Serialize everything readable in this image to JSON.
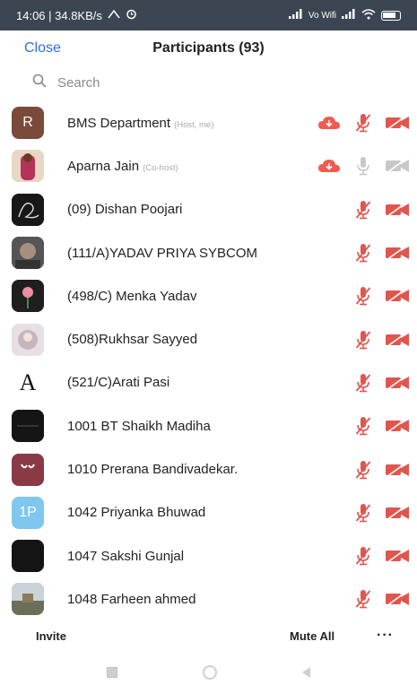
{
  "status_bar": {
    "time_speed": "14:06 | 34.8KB/s",
    "network": "Vo Wifi"
  },
  "header": {
    "close_label": "Close",
    "title": "Participants (93)"
  },
  "search": {
    "placeholder": "Search"
  },
  "colors": {
    "accent_blue": "#2d6ee0",
    "muted_red": "#e0564f",
    "cloud_red": "#f05a50",
    "inactive_gray": "#c8c8c8"
  },
  "participants": [
    {
      "name": "BMS Department",
      "role": "(Host, me)",
      "avatar_text": "R",
      "avatar_color": "#7a4a3a",
      "cloud": true,
      "mic": "muted-gray",
      "video": "off"
    },
    {
      "name": "Aparna Jain",
      "role": "(Co-host)",
      "avatar_text": "",
      "avatar_color": "#c9a58c",
      "cloud": true,
      "mic": "gray",
      "video": "gray"
    },
    {
      "name": "(09) Dishan Poojari",
      "role": "",
      "avatar_text": "",
      "avatar_color": "#1b1b1b",
      "cloud": false,
      "mic": "muted",
      "video": "off"
    },
    {
      "name": "(111/A)YADAV PRIYA SYBCOM",
      "role": "",
      "avatar_text": "",
      "avatar_color": "#4a4a4a",
      "cloud": false,
      "mic": "muted",
      "video": "off"
    },
    {
      "name": "(498/C) Menka Yadav",
      "role": "",
      "avatar_text": "",
      "avatar_color": "#1f1f1f",
      "cloud": false,
      "mic": "muted",
      "video": "off"
    },
    {
      "name": "(508)Rukhsar Sayyed",
      "role": "",
      "avatar_text": "",
      "avatar_color": "#d9cfd6",
      "cloud": false,
      "mic": "muted",
      "video": "off"
    },
    {
      "name": "(521/C)Arati Pasi",
      "role": "",
      "avatar_text": "A",
      "avatar_color": "#ffffff",
      "cloud": false,
      "mic": "muted",
      "video": "off"
    },
    {
      "name": "1001 BT Shaikh Madiha",
      "role": "",
      "avatar_text": "",
      "avatar_color": "#151515",
      "cloud": false,
      "mic": "muted",
      "video": "off"
    },
    {
      "name": "1010 Prerana Bandivadekar.",
      "role": "",
      "avatar_text": "",
      "avatar_color": "#8a3a46",
      "cloud": false,
      "mic": "muted",
      "video": "off"
    },
    {
      "name": "1042 Priyanka Bhuwad",
      "role": "",
      "avatar_text": "1P",
      "avatar_color": "#7fc7ee",
      "cloud": false,
      "mic": "muted",
      "video": "off"
    },
    {
      "name": "1047 Sakshi Gunjal",
      "role": "",
      "avatar_text": "",
      "avatar_color": "#141414",
      "cloud": false,
      "mic": "muted",
      "video": "off"
    },
    {
      "name": "1048 Farheen ahmed",
      "role": "",
      "avatar_text": "",
      "avatar_color": "#6b6f5a",
      "cloud": false,
      "mic": "muted",
      "video": "off"
    }
  ],
  "footer": {
    "invite_label": "Invite",
    "mute_all_label": "Mute All",
    "more_label": "···"
  }
}
